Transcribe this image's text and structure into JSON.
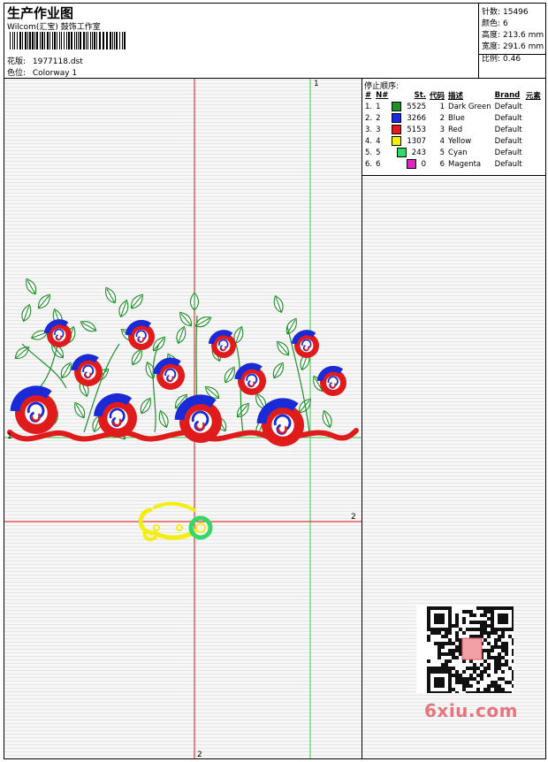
{
  "header": {
    "title": "生产作业图",
    "studio": "Wilcom(汇宝) 鼓饰工作室",
    "design_label": "花版:",
    "design_value": "1977118.dst",
    "colorway_label": "色位:",
    "colorway_value": "Colorway 1"
  },
  "stats": {
    "stitches_label": "针数:",
    "stitches_value": "15496",
    "colors_label": "颜色:",
    "colors_value": "6",
    "height_label": "高度:",
    "height_value": "213.6 mm",
    "width_label": "宽度:",
    "width_value": "291.6 mm",
    "scale_label": "比例:",
    "scale_value": "0.46"
  },
  "stop_sequence": {
    "title": "停止顺序:",
    "headers": [
      "#",
      "N#",
      "St.",
      "代码",
      "描述",
      "Brand",
      "元素"
    ],
    "rows": [
      {
        "idx": "1.",
        "n": "1",
        "color": "#1f8f2a",
        "st": "5525",
        "code": "1",
        "desc": "Dark Green",
        "brand": "Default"
      },
      {
        "idx": "2.",
        "n": "2",
        "color": "#1a2ad6",
        "st": "3266",
        "code": "2",
        "desc": "Blue",
        "brand": "Default"
      },
      {
        "idx": "3.",
        "n": "3",
        "color": "#e01b1b",
        "st": "5153",
        "code": "3",
        "desc": "Red",
        "brand": "Default"
      },
      {
        "idx": "4.",
        "n": "4",
        "color": "#f2ee10",
        "st": "1307",
        "code": "4",
        "desc": "Yellow",
        "brand": "Default"
      },
      {
        "idx": "5.",
        "n": "5",
        "color": "#35d66a",
        "st": "243",
        "code": "5",
        "desc": "Cyan",
        "brand": "Default"
      },
      {
        "idx": "6.",
        "n": "6",
        "color": "#e620c8",
        "st": "0",
        "code": "6",
        "desc": "Magenta",
        "brand": "Default"
      }
    ]
  },
  "axes": {
    "green_top": "1",
    "green_left": "1",
    "red_right": "2",
    "red_bottom": "2"
  },
  "watermark": {
    "site": "6xiu.com"
  }
}
